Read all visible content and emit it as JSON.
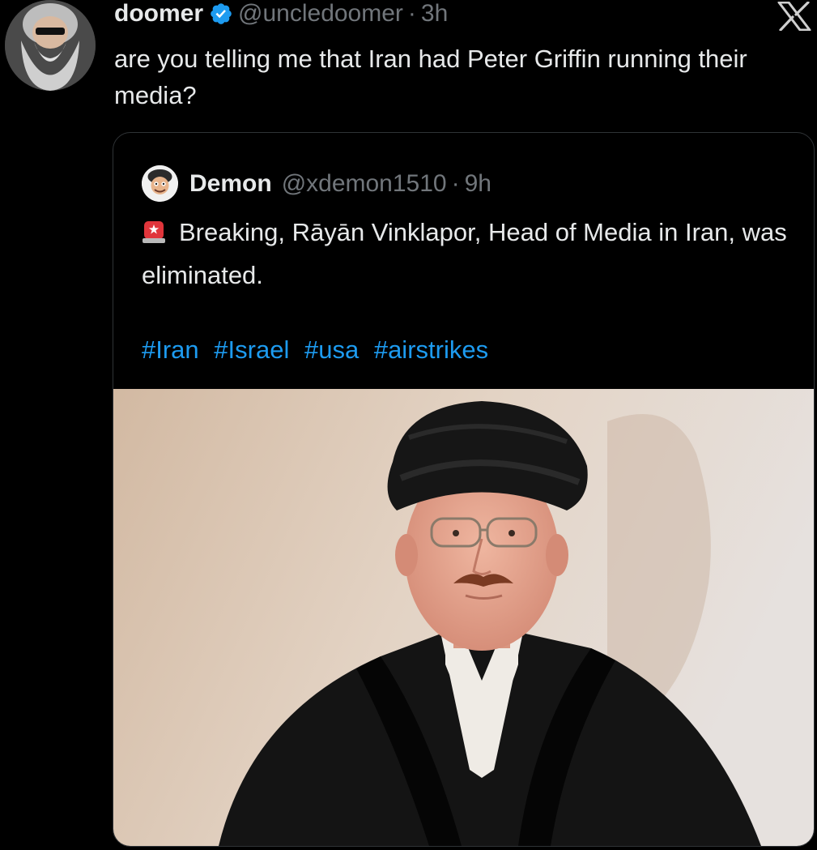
{
  "tweet": {
    "author_name": "doomer",
    "author_handle": "@uncledoomer",
    "separator": "·",
    "time": "3h",
    "text": "are you telling me that Iran had Peter Griffin running their media?",
    "avatar_icon": "bearded-man-sunglasses-avatar",
    "verified_icon": "verified-badge-icon",
    "logo_icon": "x-logo-icon"
  },
  "quote": {
    "author_name": "Demon",
    "author_handle": "@xdemon1510",
    "separator": "·",
    "time": "9h",
    "siren_icon": "rotating-light-emoji",
    "text": "Breaking, Rāyān Vinklapor, Head of Media in Iran, was eliminated.",
    "hashtags": [
      "#Iran",
      "#Israel",
      "#usa",
      "#airstrikes"
    ],
    "media": "photo-of-man-in-black-turban-and-robe-with-glasses-and-mustache"
  },
  "colors": {
    "background": "#000000",
    "text": "#e7e9ea",
    "muted": "#71767b",
    "link": "#1d9bf0",
    "border": "#2f3336",
    "verified": "#1d9bf0"
  }
}
